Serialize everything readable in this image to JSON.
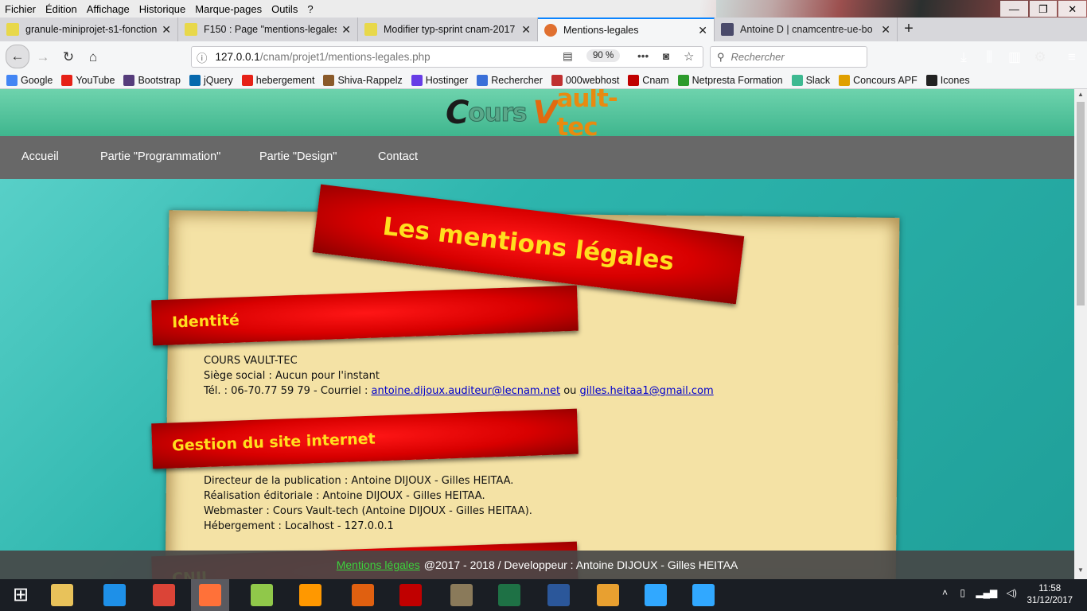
{
  "menubar": {
    "items": [
      "Fichier",
      "Édition",
      "Affichage",
      "Historique",
      "Marque-pages",
      "Outils",
      "?"
    ]
  },
  "window_controls": {
    "minimize": "—",
    "restore": "❐",
    "close": "✕"
  },
  "tabs": [
    {
      "title": "granule-miniprojet-s1-fonction",
      "active": false
    },
    {
      "title": "F150 : Page \"mentions-legales.php",
      "active": false
    },
    {
      "title": "Modifier typ-sprint cnam-2017",
      "active": false
    },
    {
      "title": "Mentions-legales",
      "active": true
    },
    {
      "title": "Antoine D | cnamcentre-ue-bo",
      "active": false
    }
  ],
  "tab_close_glyph": "✕",
  "new_tab_glyph": "+",
  "nav": {
    "url_host": "127.0.0.1",
    "url_path": "/cnam/projet1/mentions-legales.php",
    "zoom": "90 %",
    "search_placeholder": "Rechercher"
  },
  "bookmarks": [
    {
      "label": "Google",
      "color": "#4285f4"
    },
    {
      "label": "YouTube",
      "color": "#e62117"
    },
    {
      "label": "Bootstrap",
      "color": "#563d7c"
    },
    {
      "label": "jQuery",
      "color": "#0769ad"
    },
    {
      "label": "hebergement",
      "color": "#e62117"
    },
    {
      "label": "Shiva-Rappelz",
      "color": "#8a5a2a"
    },
    {
      "label": "Hostinger",
      "color": "#673de6"
    },
    {
      "label": "Rechercher",
      "color": "#3a6fd8"
    },
    {
      "label": "000webhost",
      "color": "#c03030"
    },
    {
      "label": "Cnam",
      "color": "#c00000"
    },
    {
      "label": "Netpresta Formation",
      "color": "#2d9b2d"
    },
    {
      "label": "Slack",
      "color": "#3eb991"
    },
    {
      "label": "Concours APF",
      "color": "#e0a000"
    },
    {
      "label": "Icones",
      "color": "#222222"
    }
  ],
  "site": {
    "logo": {
      "c": "C",
      "ours": "ours",
      "v": "V",
      "ault": "ault-tec"
    },
    "nav": [
      "Accueil",
      "Partie \"Programmation\"",
      "Partie \"Design\"",
      "Contact"
    ],
    "title": "Les mentions légales",
    "sections": [
      {
        "heading": "Identité",
        "lines": [
          "COURS VAULT-TEC",
          "Siège social : Aucun pour l'instant"
        ],
        "contact_prefix": "Tél. : 06-70.77 59 79 - Courriel : ",
        "email1": "antoine.dijoux.auditeur@lecnam.net",
        "or": " ou ",
        "email2": "gilles.heitaa1@gmail.com"
      },
      {
        "heading": "Gestion du site internet",
        "lines": [
          "Directeur de la publication : Antoine DIJOUX - Gilles HEITAA.",
          "Réalisation éditoriale : Antoine DIJOUX - Gilles HEITAA.",
          "Webmaster : Cours Vault-tech (Antoine DIJOUX - Gilles HEITAA).",
          "Hébergement : Localhost - 127.0.0.1"
        ]
      },
      {
        "heading": "CNIL"
      }
    ],
    "footer": {
      "link": "Mentions légales",
      "text": "@2017 - 2018 / Developpeur : Antoine DIJOUX - Gilles HEITAA"
    }
  },
  "taskbar": {
    "apps": [
      "Start",
      "File Explorer",
      "Internet Explorer",
      "Chrome",
      "Firefox",
      "Notepad++",
      "Sublime Text",
      "21",
      "FileZilla",
      "GIMP",
      "Excel",
      "Word",
      "Paint",
      "Photoshop",
      "Photoshop"
    ],
    "app_colors": [
      "#ffffff",
      "#e8c25a",
      "#1e90e8",
      "#db4437",
      "#ff7139",
      "#90c84a",
      "#ff9800",
      "#e06010",
      "#c00000",
      "#8a7a5a",
      "#1e7145",
      "#2b579a",
      "#e8a030",
      "#31a8ff",
      "#31a8ff"
    ],
    "time": "11:58",
    "date": "31/12/2017"
  }
}
